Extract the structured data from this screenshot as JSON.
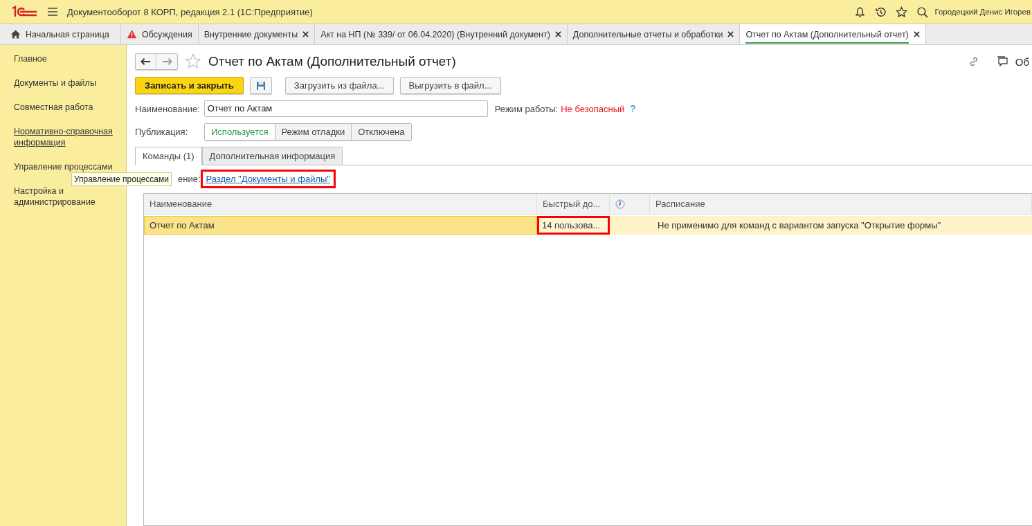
{
  "app_title": "Документооборот 8 КОРП, редакция 2.1  (1С:Предприятие)",
  "user": "Городецкий Денис Игорев",
  "tabs": [
    {
      "label": "Начальная страница",
      "kind": "home",
      "closable": false,
      "selected": false
    },
    {
      "label": "Обсуждения",
      "kind": "alert",
      "closable": false,
      "selected": false
    },
    {
      "label": "Внутренние документы",
      "kind": "plain",
      "closable": true,
      "selected": false
    },
    {
      "label": "Акт на НП (№ 339/ от 06.04.2020) (Внутренний документ)",
      "kind": "plain",
      "closable": true,
      "selected": false
    },
    {
      "label": "Дополнительные отчеты и обработки",
      "kind": "plain",
      "closable": true,
      "selected": false
    },
    {
      "label": "Отчет по Актам (Дополнительный отчет)",
      "kind": "plain",
      "closable": true,
      "selected": true
    }
  ],
  "sidebar": {
    "items": [
      {
        "label": "Главное",
        "selected": false
      },
      {
        "label": "Документы и файлы",
        "selected": false
      },
      {
        "label": "Совместная работа",
        "selected": false
      },
      {
        "label": "Нормативно-справочная информация",
        "selected": true
      },
      {
        "label": "Управление процессами",
        "selected": false
      },
      {
        "label": "Настройка и администрирование",
        "selected": false
      }
    ],
    "tooltip": "Управление процессами"
  },
  "form": {
    "title": "Отчет по Актам (Дополнительный отчет)",
    "discuss_label": "Об",
    "buttons": [
      {
        "label": "Записать и закрыть",
        "kind": "primary"
      },
      {
        "kind": "save"
      },
      {
        "label": "Загрузить из файла...",
        "kind": "normal"
      },
      {
        "label": "Выгрузить в файл...",
        "kind": "normal"
      }
    ],
    "name_label": "Наименование:",
    "name_value": "Отчет по Актам",
    "mode_label": "Режим работы:",
    "mode_value": "Не безопасный",
    "mode_help": "?",
    "publication_label": "Публикация:",
    "publication": [
      {
        "label": "Используется",
        "selected": true
      },
      {
        "label": "Режим отладки",
        "selected": false
      },
      {
        "label": "Отключена",
        "selected": false
      }
    ],
    "subtabs": [
      {
        "label": "Команды (1)",
        "selected": true
      },
      {
        "label": "Дополнительная информация",
        "selected": false
      }
    ],
    "placement_label": "ение:",
    "placement_link": "Раздел \"Документы и файлы\"",
    "placement_highlighted": true,
    "table": {
      "columns": [
        {
          "label": "Наименование",
          "kind": "text"
        },
        {
          "label": "Быстрый до...",
          "kind": "text"
        },
        {
          "kind": "clock"
        },
        {
          "label": "Расписание",
          "kind": "text"
        }
      ],
      "rows": [
        {
          "selected": true,
          "cells": [
            {
              "text": "Отчет по Актам",
              "highlighted": false
            },
            {
              "text": "14 пользова...",
              "highlighted": true
            },
            {
              "highlighted": false
            },
            {
              "text": "Не применимо для команд с вариантом запуска \"Открытие формы\"",
              "highlighted": false
            }
          ]
        }
      ]
    }
  }
}
